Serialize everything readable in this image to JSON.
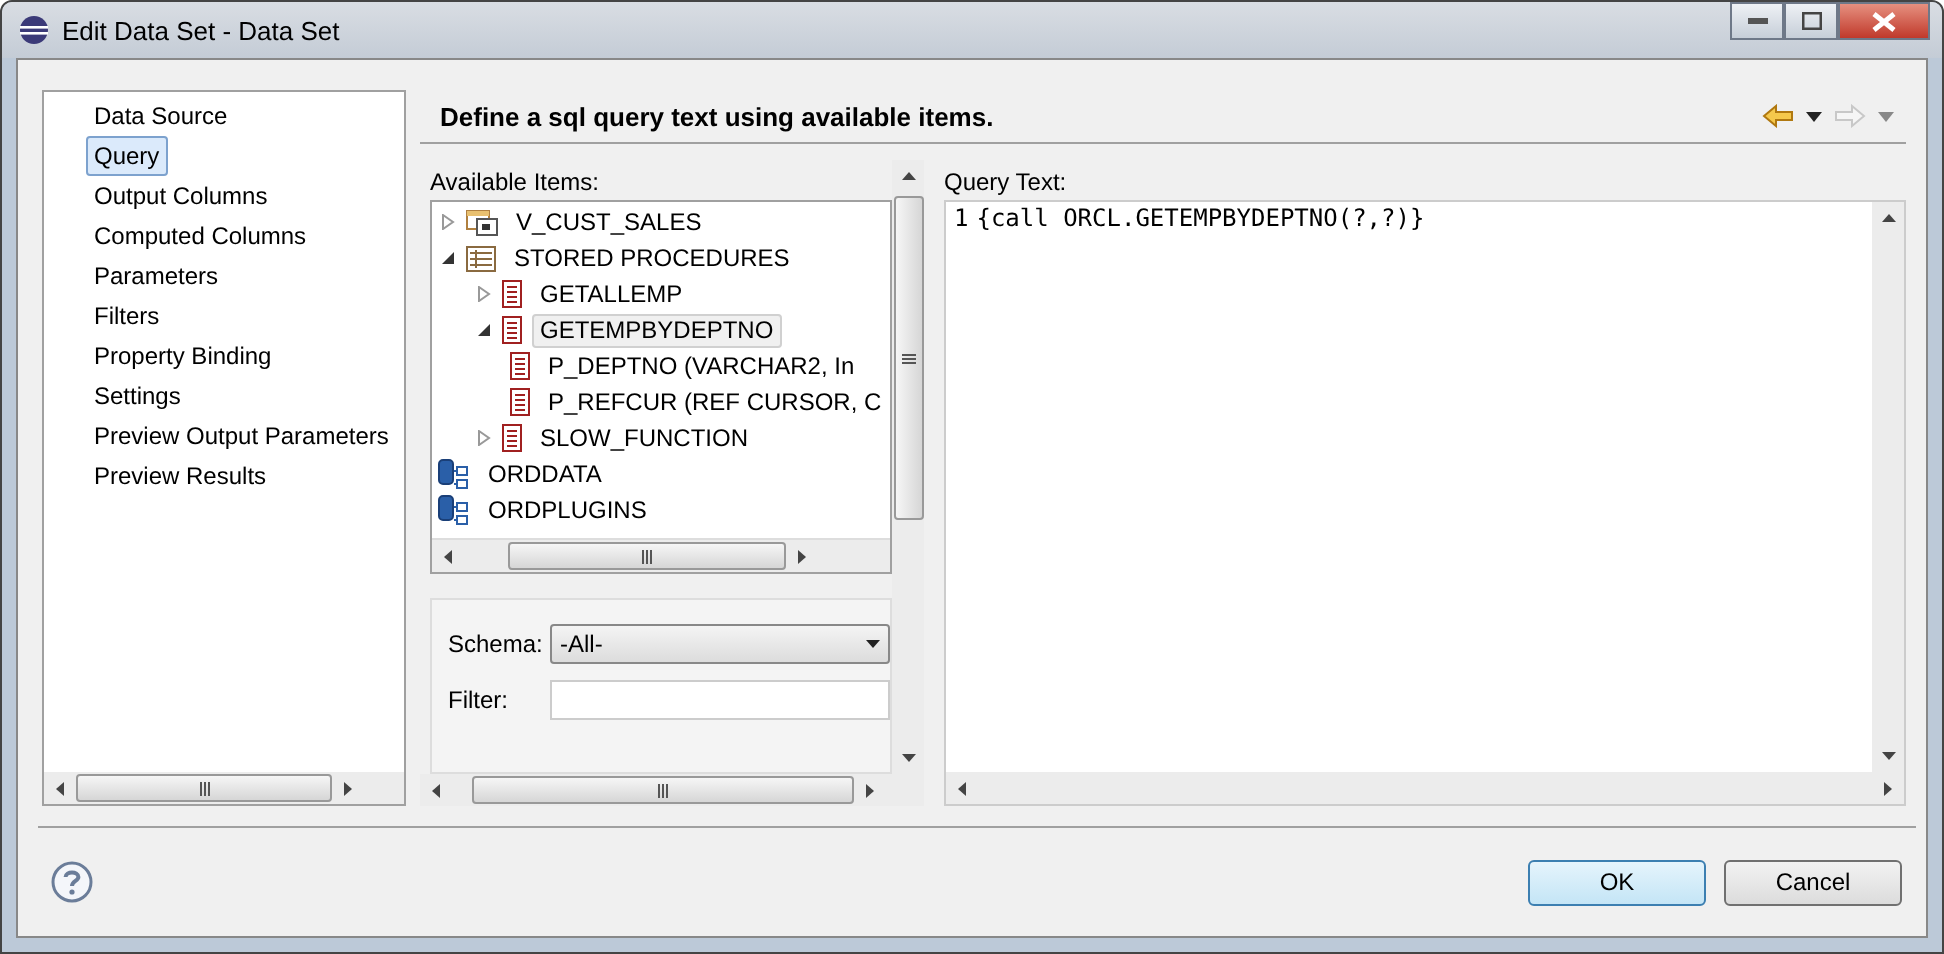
{
  "window": {
    "title": "Edit Data Set - Data Set"
  },
  "nav": {
    "items": [
      {
        "label": "Data Source",
        "selected": false
      },
      {
        "label": "Query",
        "selected": true
      },
      {
        "label": "Output Columns",
        "selected": false
      },
      {
        "label": "Computed Columns",
        "selected": false
      },
      {
        "label": "Parameters",
        "selected": false
      },
      {
        "label": "Filters",
        "selected": false
      },
      {
        "label": "Property Binding",
        "selected": false
      },
      {
        "label": "Settings",
        "selected": false
      },
      {
        "label": "Preview Output Parameters",
        "selected": false
      },
      {
        "label": "Preview Results",
        "selected": false
      }
    ]
  },
  "header": {
    "title": "Define a sql query text using available items."
  },
  "available_items": {
    "label": "Available Items:",
    "tree": [
      {
        "label": "V_CUST_SALES",
        "kind": "view",
        "expanded": false,
        "selected": false
      },
      {
        "label": "STORED PROCEDURES",
        "kind": "folder",
        "expanded": true,
        "selected": false,
        "children": [
          {
            "label": "GETALLEMP",
            "kind": "procedure",
            "expanded": false,
            "selected": false
          },
          {
            "label": "GETEMPBYDEPTNO",
            "kind": "procedure",
            "expanded": true,
            "selected": true,
            "children": [
              {
                "label": "P_DEPTNO (VARCHAR2, In",
                "kind": "parameter",
                "selected": false
              },
              {
                "label": "P_REFCUR (REF CURSOR, C",
                "kind": "parameter",
                "selected": false
              }
            ]
          },
          {
            "label": "SLOW_FUNCTION",
            "kind": "procedure",
            "expanded": false,
            "selected": false
          }
        ]
      },
      {
        "label": "ORDDATA",
        "kind": "schema",
        "selected": false
      },
      {
        "label": "ORDPLUGINS",
        "kind": "schema",
        "selected": false
      }
    ],
    "schema": {
      "label": "Schema:",
      "value": "-All-"
    },
    "filter": {
      "label": "Filter:"
    }
  },
  "query": {
    "label": "Query Text:",
    "lines": [
      {
        "number": "1",
        "text": "{call ORCL.GETEMPBYDEPTNO(?,?)}"
      }
    ]
  },
  "buttons": [
    {
      "label": "OK",
      "kind": "default"
    },
    {
      "label": "Cancel",
      "kind": "normal"
    }
  ]
}
